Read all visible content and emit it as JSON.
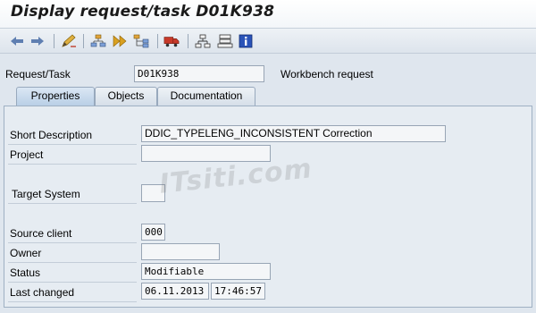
{
  "window": {
    "title": "Display request/task D01K938"
  },
  "toolbar": {
    "icons": [
      "back-arrow-icon",
      "forward-arrow-icon",
      "edit-pencil-icon",
      "hierarchy-up-icon",
      "execute-icon",
      "hierarchy-icon",
      "transport-truck-icon",
      "org-chart-icon",
      "stacked-list-icon",
      "info-icon"
    ]
  },
  "request": {
    "label": "Request/Task",
    "value": "D01K938",
    "type_text": "Workbench request"
  },
  "tabs": [
    {
      "label": "Properties",
      "active": true
    },
    {
      "label": "Objects",
      "active": false
    },
    {
      "label": "Documentation",
      "active": false
    }
  ],
  "properties": {
    "short_description": {
      "label": "Short Description",
      "value": "DDIC_TYPELENG_INCONSISTENT Correction"
    },
    "project": {
      "label": "Project",
      "value": ""
    },
    "target_system": {
      "label": "Target System",
      "value": ""
    },
    "source_client": {
      "label": "Source client",
      "value": "000"
    },
    "owner": {
      "label": "Owner",
      "value": ""
    },
    "status": {
      "label": "Status",
      "value": "Modifiable"
    },
    "last_changed": {
      "label": "Last changed",
      "date": "06.11.2013",
      "time": "17:46:57"
    }
  },
  "watermark": "ITsiti.com",
  "colors": {
    "background": "#dfe6ee",
    "field_border": "#98a5b5",
    "active_tab": "#b9cfe6"
  }
}
